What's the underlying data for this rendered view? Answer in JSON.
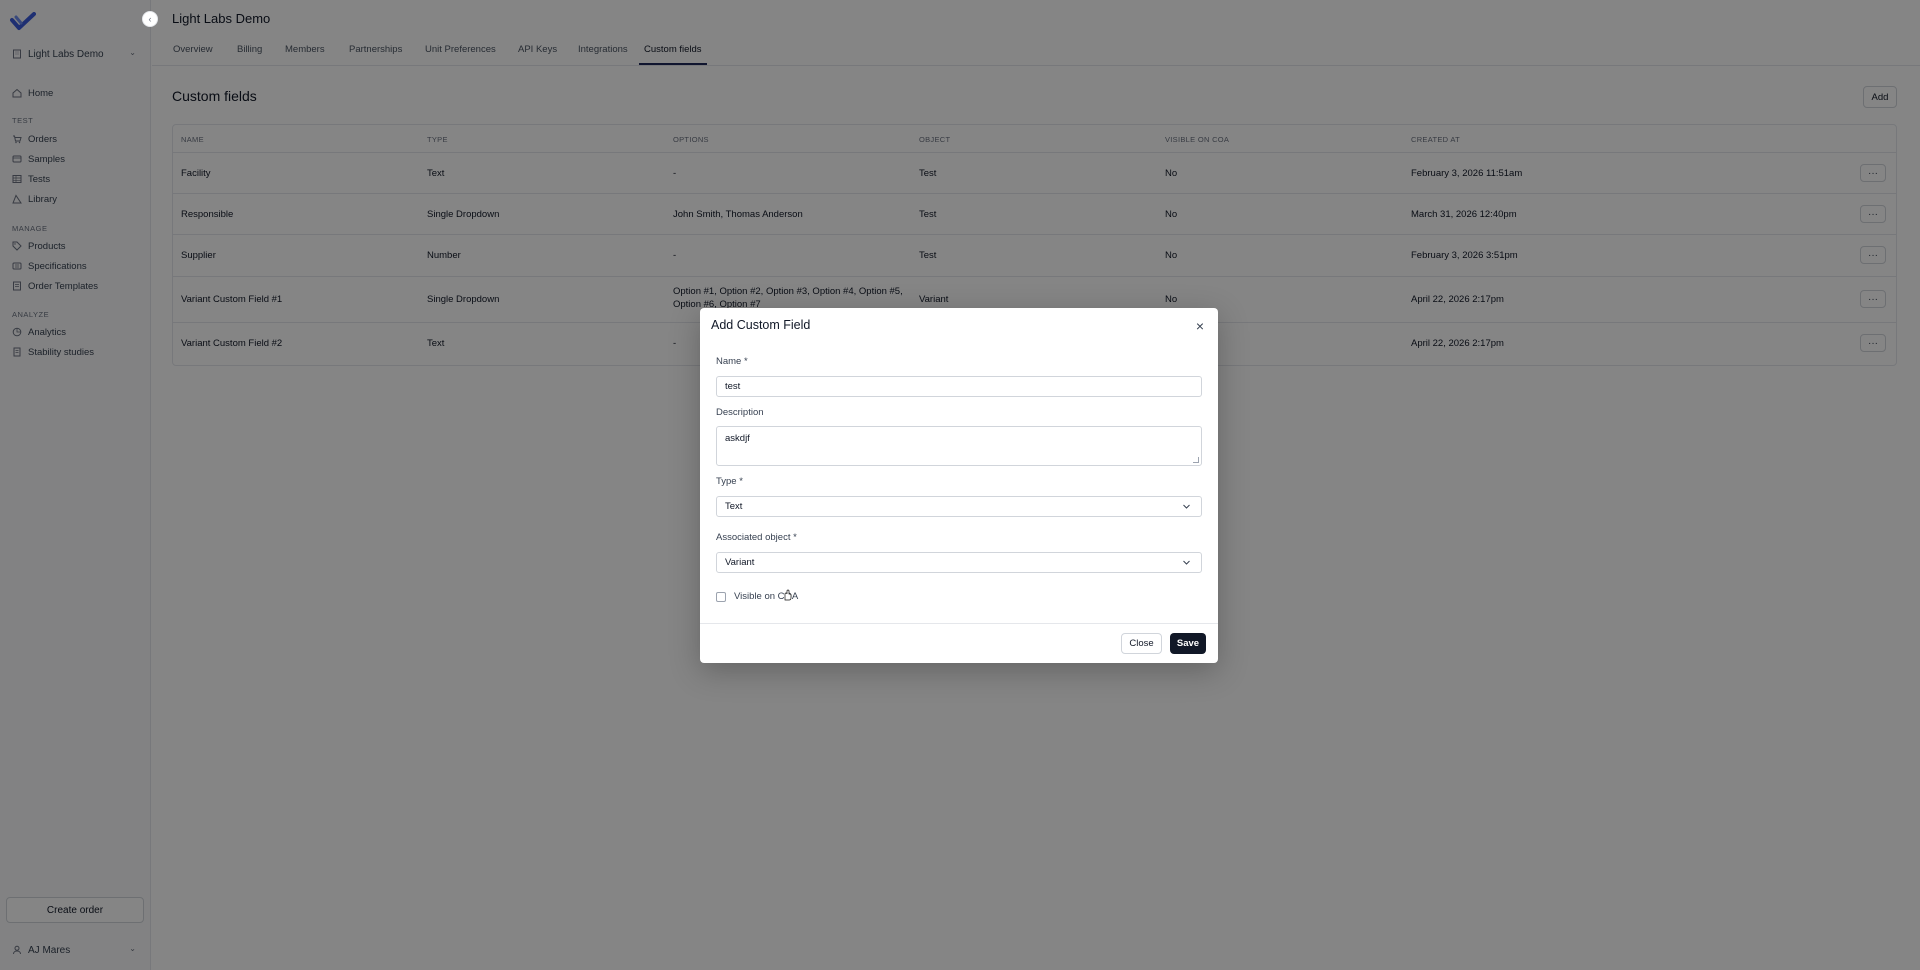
{
  "app": {
    "org_name": "Light Labs Demo",
    "page_title": "Light Labs Demo"
  },
  "sidebar": {
    "home": "Home",
    "sections": {
      "test": "TEST",
      "manage": "MANAGE",
      "analyze": "ANALYZE"
    },
    "test_items": [
      "Orders",
      "Samples",
      "Tests",
      "Library"
    ],
    "manage_items": [
      "Products",
      "Specifications",
      "Order Templates"
    ],
    "analyze_items": [
      "Analytics",
      "Stability studies"
    ],
    "create_order": "Create order",
    "user_name": "AJ Mares"
  },
  "tabs": [
    "Overview",
    "Billing",
    "Members",
    "Partnerships",
    "Unit Preferences",
    "API Keys",
    "Integrations",
    "Custom fields"
  ],
  "active_tab": "Custom fields",
  "section": {
    "title": "Custom fields",
    "add_label": "Add"
  },
  "table": {
    "headers": [
      "NAME",
      "TYPE",
      "OPTIONS",
      "OBJECT",
      "VISIBLE ON COA",
      "CREATED AT"
    ],
    "row_menu": "···",
    "rows": [
      {
        "name": "Facility",
        "type": "Text",
        "options": "-",
        "object": "Test",
        "visible": "No",
        "created": "February 3, 2026 11:51am"
      },
      {
        "name": "Responsible",
        "type": "Single Dropdown",
        "options": "John Smith, Thomas Anderson",
        "object": "Test",
        "visible": "No",
        "created": "March 31, 2026 12:40pm"
      },
      {
        "name": "Supplier",
        "type": "Number",
        "options": "-",
        "object": "Test",
        "visible": "No",
        "created": "February 3, 2026 3:51pm"
      },
      {
        "name": "Variant Custom Field #1",
        "type": "Single Dropdown",
        "options": "Option #1, Option #2, Option #3, Option #4, Option #5, Option #6, Option #7",
        "object": "Variant",
        "visible": "No",
        "created": "April 22, 2026 2:17pm"
      },
      {
        "name": "Variant Custom Field #2",
        "type": "Text",
        "options": "-",
        "object": "",
        "visible": "",
        "created": "April 22, 2026 2:17pm"
      }
    ]
  },
  "modal": {
    "title": "Add Custom Field",
    "name_label": "Name",
    "name_value": "test",
    "description_label": "Description",
    "description_value": "askdjf",
    "type_label": "Type",
    "type_value": "Text",
    "object_label": "Associated object",
    "object_value": "Variant",
    "required_mark": "*",
    "visible_label": "Visible on COA",
    "close_label": "Close",
    "save_label": "Save"
  },
  "icons": {
    "logo": "check-logo-icon",
    "close": "close-icon",
    "chevron": "chevron-down-icon"
  },
  "colors": {
    "brand": "#3b5bdb",
    "primary_button": "#111827",
    "active_tab_underline": "#1f2a5a"
  }
}
